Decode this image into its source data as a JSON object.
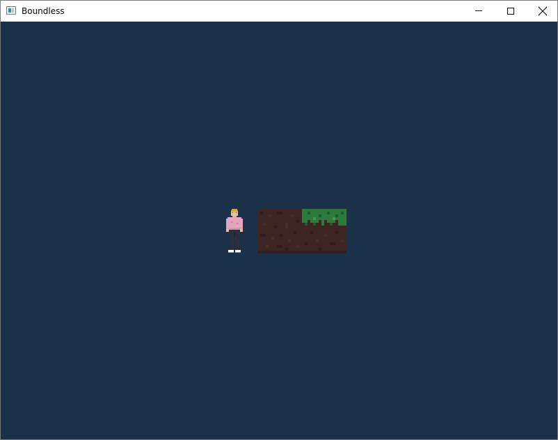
{
  "window": {
    "title": "Boundless",
    "icon": "app-window-icon",
    "controls": [
      "minimize-icon",
      "maximize-icon",
      "close-icon"
    ]
  },
  "game": {
    "background_color": "#1b3149",
    "entities": [
      "player-character"
    ],
    "blocks": [
      "dirt",
      "grass"
    ]
  }
}
